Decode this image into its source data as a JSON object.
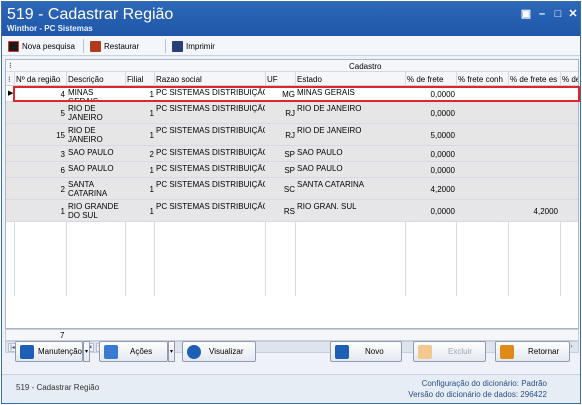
{
  "window": {
    "title": "519 - Cadastrar Região",
    "subtitle": "Winthor - PC Sistemas"
  },
  "toolbar": {
    "new_search": "Nova pesquisa",
    "restore": "Restaurar",
    "print": "Imprimir"
  },
  "grid": {
    "group_header": "Cadastro",
    "columns": [
      "Nº da região",
      "Descrição",
      "Filial",
      "Razao social",
      "UF",
      "Estado",
      "% de frete",
      "% frete conh",
      "% de frete es",
      "% de"
    ],
    "rows": [
      {
        "id": "4",
        "desc": "MINAS GERAIS",
        "filial": "1",
        "razao": "PC SISTEMAS DISTRIBUIÇÃO I",
        "uf": "MG",
        "estado": "MINAS GERAIS",
        "frete": "0,0000",
        "conh": "",
        "fretees": ""
      },
      {
        "id": "5",
        "desc": "RIO DE JANEIRO",
        "filial": "1",
        "razao": "PC SISTEMAS DISTRIBUIÇÃO I",
        "uf": "RJ",
        "estado": "RIO DE JANEIRO",
        "frete": "0,0000",
        "conh": "",
        "fretees": ""
      },
      {
        "id": "15",
        "desc": "RIO DE JANEIRO",
        "filial": "1",
        "razao": "PC SISTEMAS DISTRIBUIÇÃO I",
        "uf": "RJ",
        "estado": "RIO DE JANEIRO",
        "frete": "5,0000",
        "conh": "",
        "fretees": ""
      },
      {
        "id": "3",
        "desc": "SAO PAULO",
        "filial": "2",
        "razao": "PC SISTEMAS DISTRIBUIÇÃO I",
        "uf": "SP",
        "estado": "SAO PAULO",
        "frete": "0,0000",
        "conh": "",
        "fretees": ""
      },
      {
        "id": "6",
        "desc": "SAO PAULO",
        "filial": "1",
        "razao": "PC SISTEMAS DISTRIBUIÇÃO I",
        "uf": "SP",
        "estado": "SAO PAULO",
        "frete": "0,0000",
        "conh": "",
        "fretees": ""
      },
      {
        "id": "2",
        "desc": "SANTA CATARINA",
        "filial": "1",
        "razao": "PC SISTEMAS DISTRIBUIÇÃO I",
        "uf": "SC",
        "estado": "SANTA CATARINA",
        "frete": "4,2000",
        "conh": "",
        "fretees": ""
      },
      {
        "id": "1",
        "desc": "RIO GRANDE DO SUL",
        "filial": "1",
        "razao": "PC SISTEMAS DISTRIBUIÇÃO I",
        "uf": "RS",
        "estado": "RIO GRAN. SUL",
        "frete": "0,0000",
        "conh": "",
        "fretees": "4,2000"
      }
    ],
    "record_count": "7"
  },
  "buttons": {
    "maintenance": "Manutenção",
    "actions": "Ações",
    "view": "Visualizar",
    "new": "Novo",
    "delete": "Excluir",
    "back": "Retornar"
  },
  "status": {
    "left": "519 - Cadastrar Região",
    "dict_config_label": "Configuração do dicionário:",
    "dict_config_value": "Padrão",
    "dict_version_label": "Versão do dicionário de dados:",
    "dict_version_value": "296422"
  },
  "colors": {
    "title_bg": "#1f57a8",
    "selection_border": "#e0262c",
    "link_blue": "#2b4f86"
  },
  "icons": {
    "new_search": "new-search-icon",
    "restore": "restore-icon",
    "print": "print-icon",
    "maintenance": "maintenance-icon",
    "actions": "actions-icon",
    "view": "eye-icon",
    "new": "new-record-icon",
    "delete": "trash-icon",
    "back": "back-arrow-icon"
  }
}
